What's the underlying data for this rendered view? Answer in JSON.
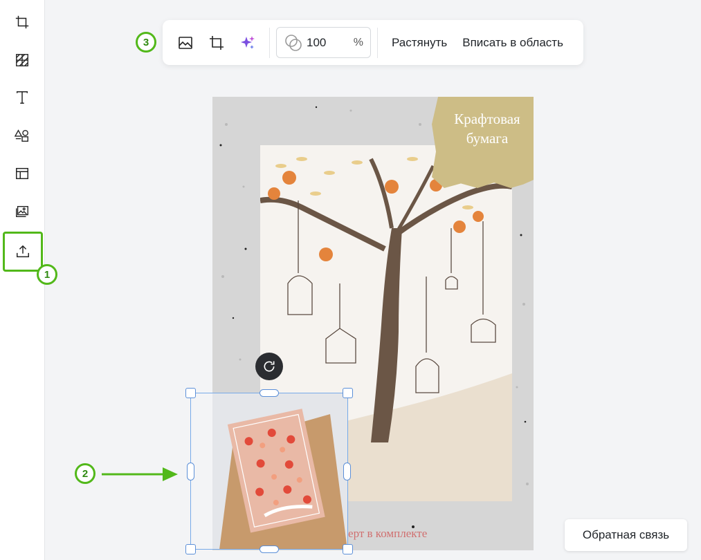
{
  "sidebar": {
    "items": [
      {
        "name": "crop-icon"
      },
      {
        "name": "pattern-icon"
      },
      {
        "name": "text-icon"
      },
      {
        "name": "shapes-icon"
      },
      {
        "name": "layout-icon"
      },
      {
        "name": "images-icon"
      },
      {
        "name": "upload-icon",
        "highlighted": true
      }
    ]
  },
  "annotations": {
    "callout_1": "1",
    "callout_2": "2",
    "callout_3": "3",
    "accent_color": "#52b81a"
  },
  "toolbar": {
    "replace_image_icon": "image-icon",
    "crop_icon": "crop-icon",
    "magic_icon": "sparkle-icon",
    "opacity_value": "100",
    "opacity_unit": "%",
    "stretch_label": "Растянуть",
    "fit_label": "Вписать в область"
  },
  "canvas": {
    "kraft_label": "Крафтовая бумага",
    "caption": "Конверт в комплекте"
  },
  "selection": {
    "rotate_icon": "rotate-icon"
  },
  "feedback_label": "Обратная связь"
}
